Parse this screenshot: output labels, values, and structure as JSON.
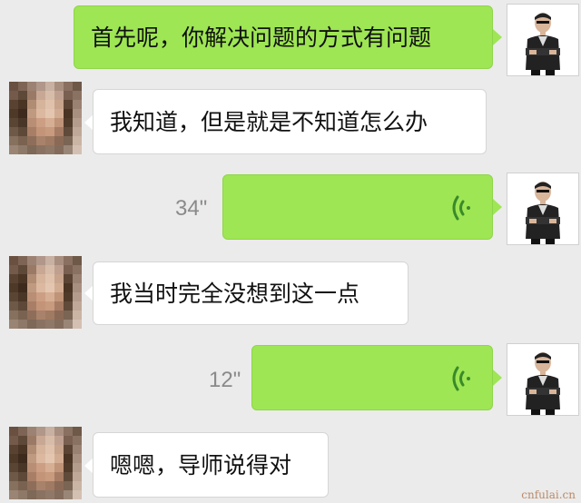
{
  "messages": [
    {
      "sender": "self",
      "type": "text",
      "text": "首先呢，你解决问题的方式有问题"
    },
    {
      "sender": "peer",
      "type": "text",
      "text": "我知道，但是就是不知道怎么办"
    },
    {
      "sender": "self",
      "type": "voice",
      "duration": "34\"",
      "icon": "voice-wave-icon"
    },
    {
      "sender": "peer",
      "type": "text",
      "text": "我当时完全没想到这一点"
    },
    {
      "sender": "self",
      "type": "voice",
      "duration": "12\"",
      "icon": "voice-wave-icon"
    },
    {
      "sender": "peer",
      "type": "text",
      "text": "嗯嗯，导师说得对"
    }
  ],
  "watermark": "cnfulai.cn",
  "colors": {
    "background": "#ebebeb",
    "self_bubble": "#9ee654",
    "peer_bubble": "#ffffff",
    "voice_icon": "#3a8a2a"
  }
}
